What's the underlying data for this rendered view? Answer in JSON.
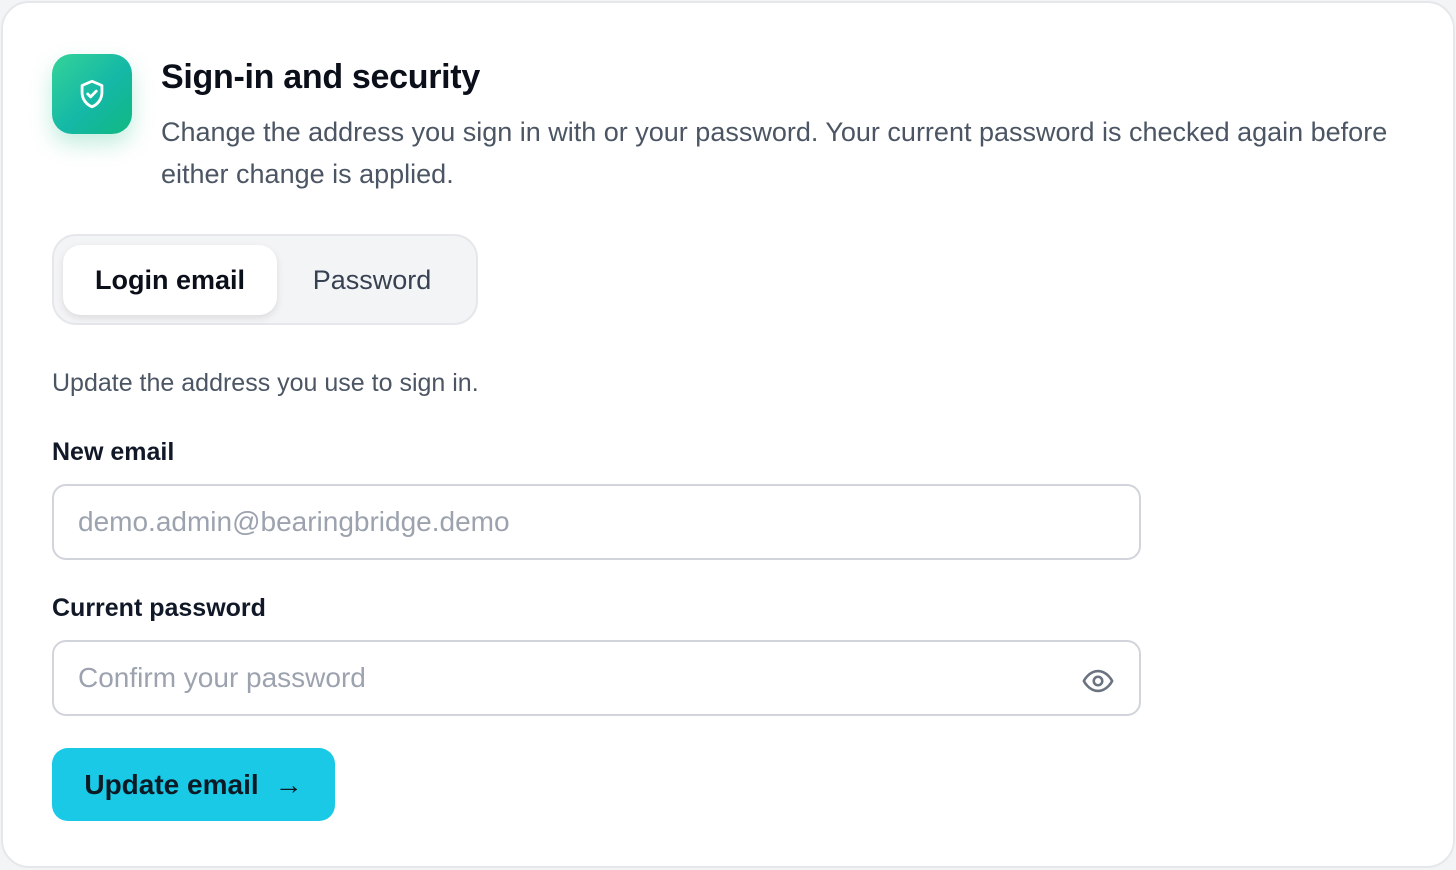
{
  "header": {
    "title": "Sign-in and security",
    "subtitle": "Change the address you sign in with or your password. Your current password is checked again before either change is applied.",
    "icon": "shield-check-icon",
    "accent_color": "#10b981"
  },
  "tabs": [
    {
      "label": "Login email",
      "active": true
    },
    {
      "label": "Password",
      "active": false
    }
  ],
  "email_section": {
    "description": "Update the address you use to sign in.",
    "new_email_label": "New email",
    "new_email_placeholder": "demo.admin@bearingbridge.demo",
    "new_email_value": "",
    "current_password_label": "Current password",
    "current_password_placeholder": "Confirm your password",
    "current_password_value": "",
    "password_toggle_icon": "eye-icon",
    "submit_label": "Update email",
    "submit_arrow": "→",
    "submit_color": "#1ac9e6"
  }
}
